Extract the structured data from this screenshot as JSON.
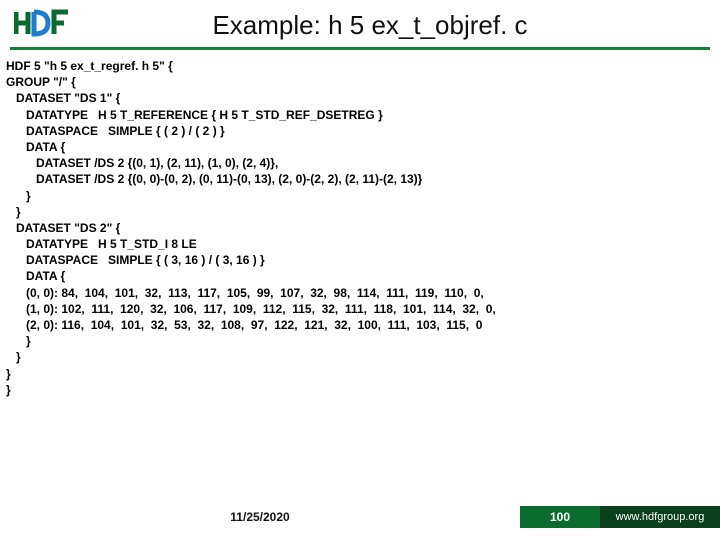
{
  "header": {
    "title": "Example: h 5 ex_t_objref. c"
  },
  "code": {
    "l01": "HDF 5 \"h 5 ex_t_regref. h 5\" {",
    "l02": "GROUP \"/\" {",
    "l03": "   DATASET \"DS 1\" {",
    "l04": "      DATATYPE   H 5 T_REFERENCE { H 5 T_STD_REF_DSETREG }",
    "l05": "      DATASPACE   SIMPLE { ( 2 ) / ( 2 ) }",
    "l06": "      DATA {",
    "l07a": "         DATASET /DS 2 {(0, 1), (2, 11), (1, 0), ",
    "l07b": "(2, 4)",
    "l07c": "},",
    "l08a": "         DATASET /DS 2 {",
    "l08b": "(0, 0)",
    "l08c": "-(0, 2), (0, 11)-(0, 13), (2, 0)-(2, 2), (2, 11)-(2, 13)}",
    "l09": "      }",
    "l10": "   }",
    "l11": "   DATASET \"DS 2\" {",
    "l12": "      DATATYPE   H 5 T_STD_I 8 LE",
    "l13": "      DATASPACE   SIMPLE { ( 3, 16 ) / ( 3, 16 ) }",
    "l14": "      DATA {",
    "l15a": "      (0, 0): ",
    "l15b": "84,  104,  101,  32,  113,  117,  105,  99,  107,  32,  98,  114,  111,  119,  110,  0,",
    "l16a": "      (1, 0): ",
    "l16b": "102,  111,  120,  32,  106,  117,  109,  112,  115,  32,  111,  118,  101,  114,  32,  0,",
    "l17a": "      (2, 0): ",
    "l17b": "116,  104,  101,  ",
    "l17c": "32",
    "l17d": ",  53,  32,  108,  97,  122,  121,  32,  100,  111,  103,  115,  0",
    "l18": "      }",
    "l19": "   }",
    "l20": "}",
    "l21": "}"
  },
  "footer": {
    "date": "11/25/2020",
    "page": "100",
    "brand": "www.hdfgroup.org"
  }
}
